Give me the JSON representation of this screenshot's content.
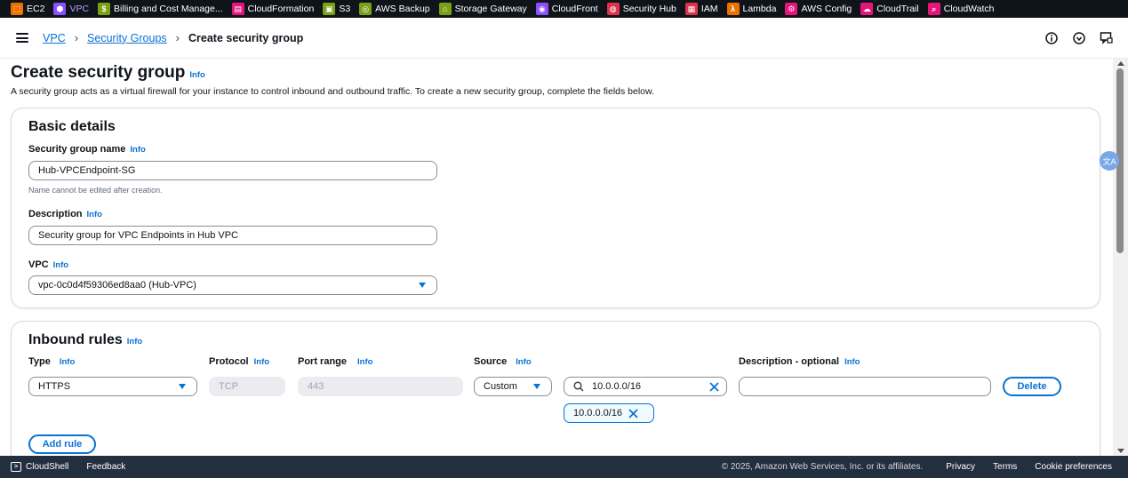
{
  "favorites": [
    {
      "label": "EC2",
      "icon": "ec2-icon",
      "color": "#ed7100",
      "glyph": "⬚",
      "active": false
    },
    {
      "label": "VPC",
      "icon": "vpc-icon",
      "color": "#8c4fff",
      "glyph": "⬢",
      "active": true
    },
    {
      "label": "Billing and Cost Manage...",
      "icon": "billing-icon",
      "color": "#7aa116",
      "glyph": "$",
      "active": false
    },
    {
      "label": "CloudFormation",
      "icon": "cloudformation-icon",
      "color": "#e7157b",
      "glyph": "▤",
      "active": false
    },
    {
      "label": "S3",
      "icon": "s3-icon",
      "color": "#7aa116",
      "glyph": "▣",
      "active": false
    },
    {
      "label": "AWS Backup",
      "icon": "backup-icon",
      "color": "#7aa116",
      "glyph": "◎",
      "active": false
    },
    {
      "label": "Storage Gateway",
      "icon": "storage-gateway-icon",
      "color": "#7aa116",
      "glyph": "⌂",
      "active": false
    },
    {
      "label": "CloudFront",
      "icon": "cloudfront-icon",
      "color": "#8c4fff",
      "glyph": "◉",
      "active": false
    },
    {
      "label": "Security Hub",
      "icon": "security-hub-icon",
      "color": "#dd344c",
      "glyph": "◍",
      "active": false
    },
    {
      "label": "IAM",
      "icon": "iam-icon",
      "color": "#dd344c",
      "glyph": "▦",
      "active": false
    },
    {
      "label": "Lambda",
      "icon": "lambda-icon",
      "color": "#ed7100",
      "glyph": "λ",
      "active": false
    },
    {
      "label": "AWS Config",
      "icon": "config-icon",
      "color": "#e7157b",
      "glyph": "⚙",
      "active": false
    },
    {
      "label": "CloudTrail",
      "icon": "cloudtrail-icon",
      "color": "#e7157b",
      "glyph": "☁",
      "active": false
    },
    {
      "label": "CloudWatch",
      "icon": "cloudwatch-icon",
      "color": "#e7157b",
      "glyph": "⌕",
      "active": false
    }
  ],
  "breadcrumb": {
    "items": [
      "VPC",
      "Security Groups"
    ],
    "current": "Create security group"
  },
  "page": {
    "title": "Create security group",
    "info": "Info",
    "description": "A security group acts as a virtual firewall for your instance to control inbound and outbound traffic. To create a new security group, complete the fields below."
  },
  "basic_details": {
    "title": "Basic details",
    "name_label": "Security group name",
    "name_value": "Hub-VPCEndpoint-SG",
    "name_hint": "Name cannot be edited after creation.",
    "description_label": "Description",
    "description_value": "Security group for VPC Endpoints in Hub VPC",
    "vpc_label": "VPC",
    "vpc_value": "vpc-0c0d4f59306ed8aa0 (Hub-VPC)",
    "info": "Info"
  },
  "inbound": {
    "title": "Inbound rules",
    "info": "Info",
    "col_type": "Type",
    "col_protocol": "Protocol",
    "col_port": "Port range",
    "col_source": "Source",
    "col_description": "Description - optional",
    "rule": {
      "type": "HTTPS",
      "protocol": "TCP",
      "port": "443",
      "source_type": "Custom",
      "source_search": "10.0.0.0/16",
      "source_token": "10.0.0.0/16",
      "description": ""
    },
    "delete_label": "Delete",
    "add_rule_label": "Add rule"
  },
  "footer": {
    "cloudshell": "CloudShell",
    "feedback": "Feedback",
    "copyright": "© 2025, Amazon Web Services, Inc. or its affiliates.",
    "privacy": "Privacy",
    "terms": "Terms",
    "cookies": "Cookie preferences"
  },
  "translate_badge": "文A"
}
